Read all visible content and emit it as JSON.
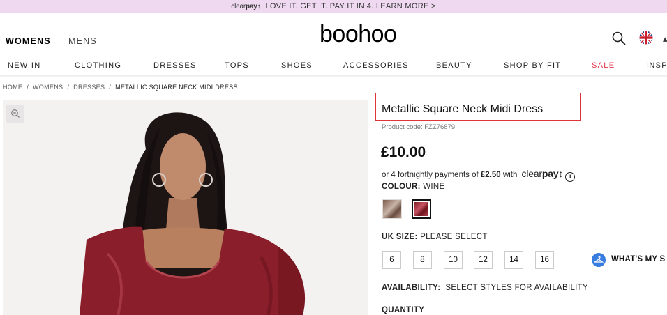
{
  "promo": {
    "brand_prefix": "clear",
    "brand_suffix": "pay",
    "message": "LOVE IT. GET IT. PAY IT IN 4. LEARN MORE >"
  },
  "header": {
    "logo": "boohoo",
    "gender_tabs": [
      "WOMENS",
      "MENS"
    ],
    "active_gender": "WOMENS"
  },
  "nav": {
    "items": [
      {
        "label": "NEW IN"
      },
      {
        "label": "CLOTHING"
      },
      {
        "label": "DRESSES"
      },
      {
        "label": "TOPS"
      },
      {
        "label": "SHOES"
      },
      {
        "label": "ACCESSORIES"
      },
      {
        "label": "BEAUTY"
      },
      {
        "label": "SHOP BY FIT"
      },
      {
        "label": "SALE",
        "color": "#e0344a"
      },
      {
        "label": "INSP"
      }
    ]
  },
  "breadcrumb": {
    "items": [
      "HOME",
      "WOMENS",
      "DRESSES",
      "METALLIC SQUARE NECK MIDI DRESS"
    ],
    "separator": "/"
  },
  "product": {
    "title": "Metallic Square Neck Midi Dress",
    "product_code": "Product code: FZZ76879",
    "price": "£10.00",
    "installment_text": "or 4 fortnightly payments of ",
    "installment_amount": "£2.50",
    "installment_with": " with ",
    "clearpay_prefix": "clear",
    "clearpay_suffix": "pay",
    "colour_label": "COLOUR:",
    "colour_value": "WINE",
    "size_label": "UK SIZE:",
    "size_value": "PLEASE SELECT",
    "sizes": [
      "6",
      "8",
      "10",
      "12",
      "14",
      "16"
    ],
    "whats_my_size": "WHAT'S MY S",
    "availability_label": "AVAILABILITY:",
    "availability_value": "SELECT STYLES FOR AVAILABILITY",
    "quantity_label": "QUANTITY"
  },
  "colors": {
    "promo_bg": "#efd9f1",
    "sale": "#e0344a",
    "highlight_border": "#e0343c",
    "dress": "#8a1e2b",
    "fit_icon": "#3a7de0"
  }
}
